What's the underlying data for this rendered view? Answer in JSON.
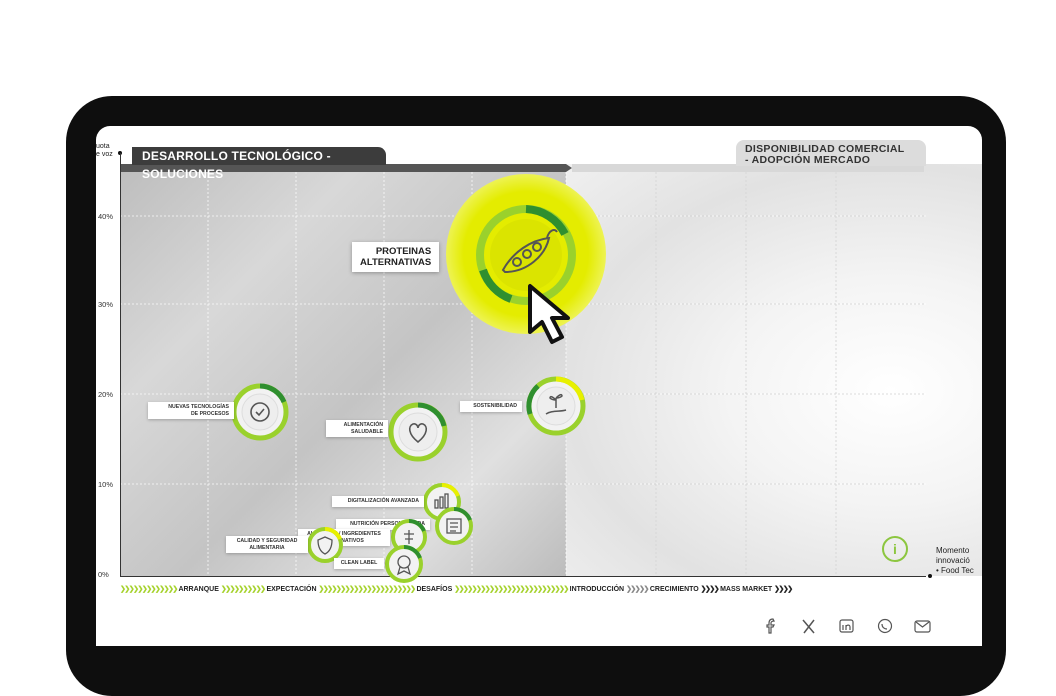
{
  "chart": {
    "yaxis_label": "Cuota de voz",
    "yaxis_label_visible": "uota\ne voz",
    "yticks": [
      "40%",
      "30%",
      "20%",
      "10%",
      "0%"
    ],
    "left_header": "DESARROLLO TECNOLÓGICO - SOLUCIONES",
    "right_header": "DISPONIBILIDAD COMERCIAL\n- ADOPCIÓN MERCADO",
    "xaxis_label": "Momento innovación Food Tech",
    "xaxis_label_lines": [
      "Momento",
      "innovació",
      "• Food Tec"
    ],
    "stages": [
      {
        "label": "ARRANQUE"
      },
      {
        "label": "EXPECTACIÓN"
      },
      {
        "label": "DESAFÍOS"
      },
      {
        "label": "INTRODUCCIÓN"
      },
      {
        "label": "CRECIMIENTO"
      },
      {
        "label": "MASS MARKET"
      }
    ],
    "highlight_color": "#e8f000",
    "accent_color": "#8cc63f"
  },
  "chart_data": {
    "type": "scatter",
    "ylabel": "Cuota de voz",
    "yticks": [
      "0%",
      "10%",
      "20%",
      "30%",
      "40%"
    ],
    "ylim": [
      0,
      45
    ],
    "xlabel": "Momento innovación Food Tech",
    "x_categories": [
      "ARRANQUE",
      "EXPECTACIÓN",
      "DESAFÍOS",
      "INTRODUCCIÓN",
      "CRECIMIENTO",
      "MASS MARKET"
    ],
    "grid": true,
    "points": [
      {
        "name": "PROTEINAS ALTERNATIVAS",
        "y": 38,
        "stage": "DESAFÍOS",
        "highlighted": true,
        "icon": "pea-pod-icon"
      },
      {
        "name": "NUEVAS TECNOLOGÍAS DE PROCESOS",
        "y": 18.5,
        "stage": "ARRANQUE",
        "icon": "recycle-gear-icon"
      },
      {
        "name": "ALIMENTACIÓN SALUDABLE",
        "y": 16,
        "stage": "EXPECTACIÓN",
        "icon": "heart-icon"
      },
      {
        "name": "SOSTENIBILIDAD",
        "y": 19,
        "stage": "DESAFÍOS",
        "icon": "hand-plant-icon"
      },
      {
        "name": "DIGITALIZACIÓN AVANZADA",
        "y": 8.5,
        "stage": "EXPECTACIÓN",
        "icon": "chart-icon"
      },
      {
        "name": "NUTRICIÓN PERSONALIZADA",
        "y": 5.5,
        "stage": "EXPECTACIÓN",
        "icon": "dna-icon"
      },
      {
        "name": "ALIMENTOS / INGREDIENTES ALTERNATIVOS",
        "y": 4,
        "stage": "EXPECTACIÓN",
        "icon": "ingredient-icon"
      },
      {
        "name": "CALIDAD Y SEGURIDAD ALIMENTARIA",
        "y": 3,
        "stage": "ARRANQUE",
        "icon": "shield-check-icon"
      },
      {
        "name": "CLEAN LABEL",
        "y": 1,
        "stage": "EXPECTACIÓN",
        "icon": "medal-icon"
      }
    ]
  },
  "labels": {
    "proteinas": "PROTEINAS\nALTERNATIVAS",
    "nuevas": "NUEVAS TECNOLOGÍAS\nDE PROCESOS",
    "saludable": "ALIMENTACIÓN\nSALUDABLE",
    "sostenibilidad": "SOSTENIBILIDAD",
    "digitalizacion": "DIGITALIZACIÓN AVANZADA",
    "nutricion": "NUTRICIÓN PERSONALIZADA",
    "alimentos": "ALIMENTOS / INGREDIENTES\nALTERNATIVOS",
    "calidad": "CALIDAD Y SEGURIDAD\nALIMENTARIA",
    "clean": "CLEAN LABEL"
  },
  "info_button": "i",
  "social": [
    "facebook-icon",
    "x-icon",
    "linkedin-icon",
    "whatsapp-icon",
    "mail-icon"
  ]
}
